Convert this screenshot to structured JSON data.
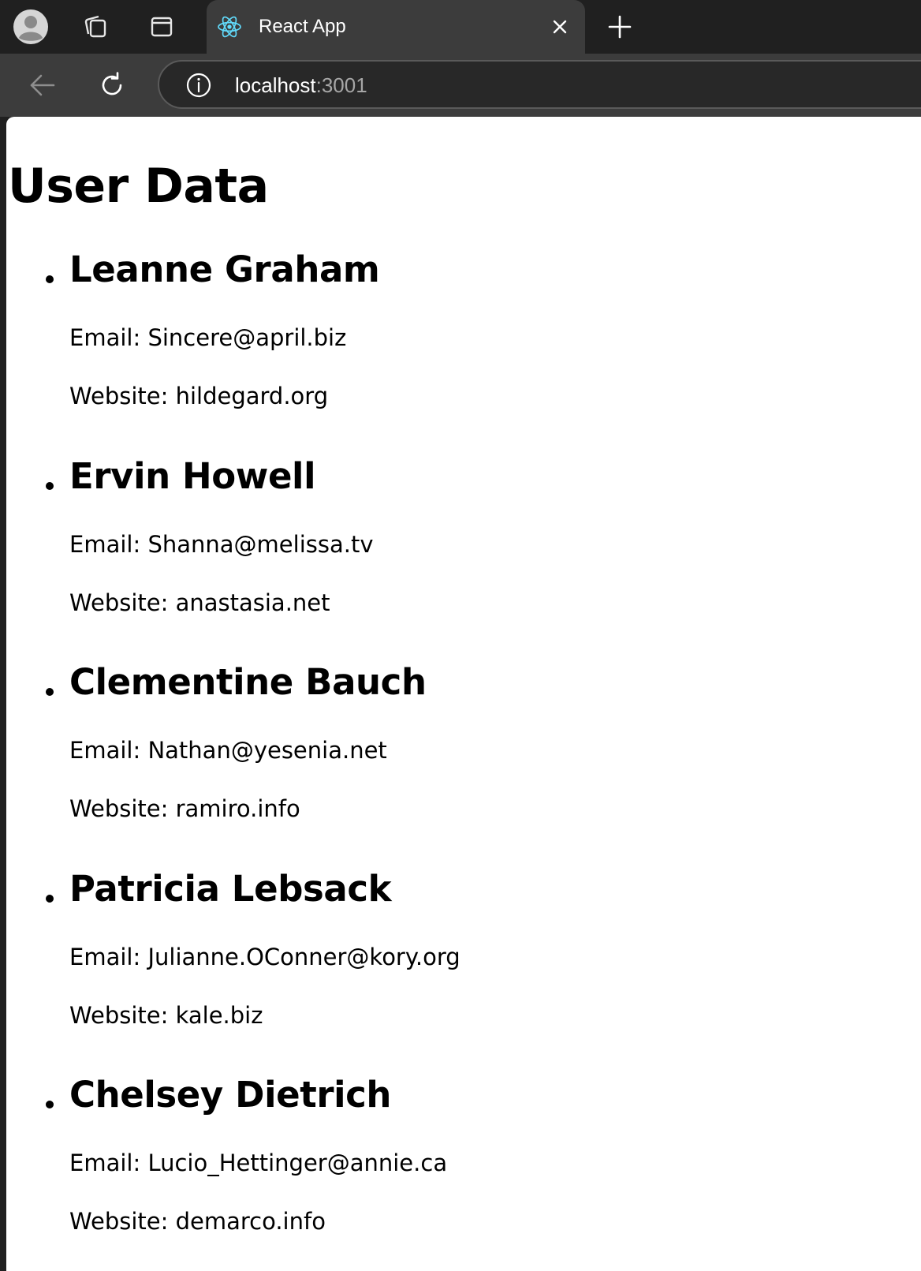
{
  "browser": {
    "tab": {
      "title": "React App",
      "favicon": "react-logo-icon"
    },
    "address": {
      "host": "localhost",
      "port": ":3001"
    },
    "icons": {
      "profile": "profile-avatar-icon",
      "collections": "collections-icon",
      "vertical_tabs": "vertical-tabs-icon",
      "close": "close-icon",
      "new_tab": "plus-icon",
      "back": "back-arrow-icon",
      "reload": "reload-icon",
      "site_info": "info-icon"
    },
    "colors": {
      "frame": "#202020",
      "tab": "#3c3c3c",
      "react": "#61dafb"
    }
  },
  "page": {
    "title": "User Data",
    "email_label": "Email: ",
    "website_label": "Website: ",
    "users": [
      {
        "name": "Leanne Graham",
        "email": "Sincere@april.biz",
        "website": "hildegard.org"
      },
      {
        "name": "Ervin Howell",
        "email": "Shanna@melissa.tv",
        "website": "anastasia.net"
      },
      {
        "name": "Clementine Bauch",
        "email": "Nathan@yesenia.net",
        "website": "ramiro.info"
      },
      {
        "name": "Patricia Lebsack",
        "email": "Julianne.OConner@kory.org",
        "website": "kale.biz"
      },
      {
        "name": "Chelsey Dietrich",
        "email": "Lucio_Hettinger@annie.ca",
        "website": "demarco.info"
      }
    ]
  }
}
